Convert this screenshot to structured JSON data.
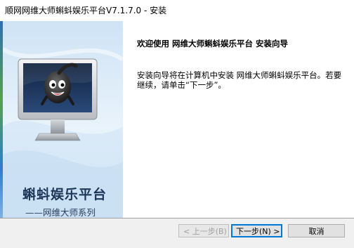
{
  "window": {
    "title": "顺网网维大师蝌蚪娱乐平台V7.1.7.0 - 安装"
  },
  "sidebar": {
    "brand_name": "蝌蚪娱乐平台",
    "series_label": "——网维大师系列",
    "mascot_icon": "tadpole-mascot-monitor-icon"
  },
  "content": {
    "welcome_heading": "欢迎使用 网维大师蝌蚪娱乐平台 安装向导",
    "description": "安装向导将在计算机中安装 网维大师蝌蚪娱乐平台。若要继续，请单击“下一步”。"
  },
  "buttons": {
    "back_label": "< 上一步(B)",
    "next_label": "下一步(N) >",
    "cancel_label": "取消"
  },
  "colors": {
    "sidebar_bg": "#dcebf8",
    "brand_text": "#1c3658",
    "default_button_border": "#0078d7"
  }
}
